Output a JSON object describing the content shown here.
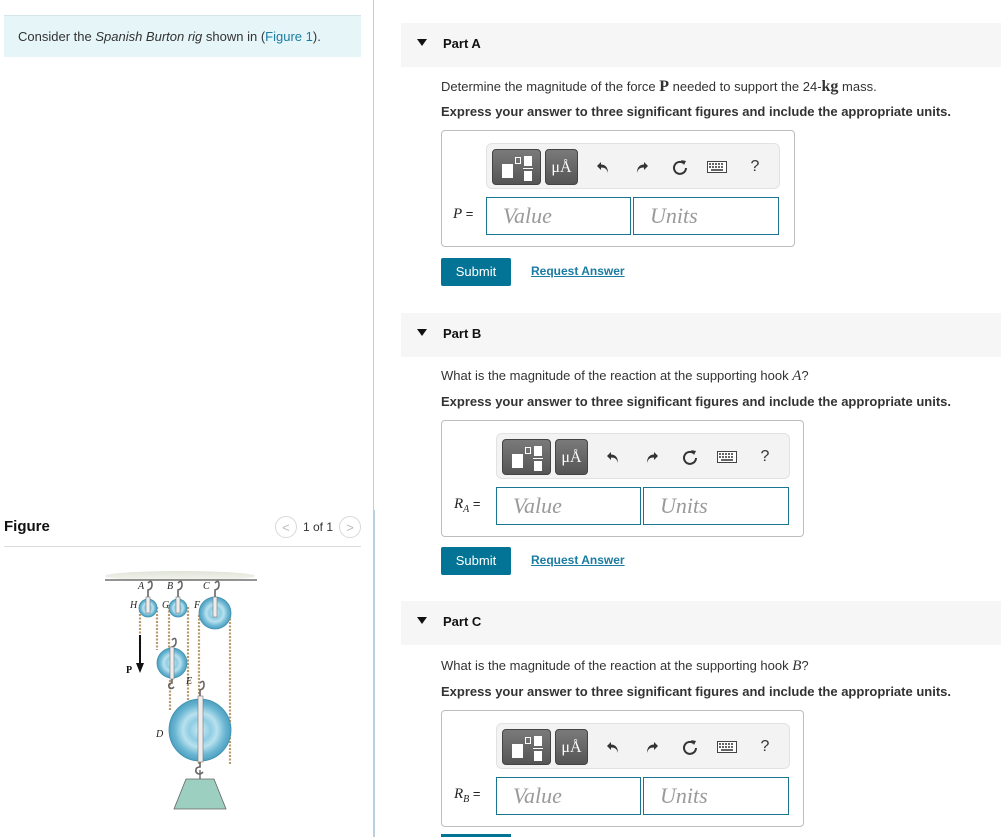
{
  "intro": {
    "prefix": "Consider the ",
    "italic": "Spanish Burton rig",
    "middle": " shown in (",
    "link": "Figure 1",
    "suffix": ")."
  },
  "figure": {
    "title": "Figure",
    "pager": {
      "prev": "<",
      "text": "1 of 1",
      "next": ">"
    },
    "labels": {
      "A": "A",
      "B": "B",
      "C": "C",
      "H": "H",
      "G": "G",
      "F": "F",
      "E": "E",
      "D": "D",
      "P": "P"
    }
  },
  "toolbar": {
    "template_icon": "template-icon",
    "units_label": "μÅ",
    "undo_icon": "undo-icon",
    "redo_icon": "redo-icon",
    "reset_icon": "reset-icon",
    "keyboard_icon": "keyboard-icon",
    "help_label": "?"
  },
  "parts": [
    {
      "title": "Part A",
      "question_pre": "Determine the magnitude of the force ",
      "question_sym": "P",
      "question_mid": " needed to support the 24-",
      "question_unit": "kg",
      "question_post": " mass.",
      "instruction": "Express your answer to three significant figures and include the appropriate units.",
      "eq_var": "P",
      "eq_sub": "",
      "eq_sign": " =",
      "value_placeholder": "Value",
      "units_placeholder": "Units",
      "submit": "Submit",
      "request": "Request Answer"
    },
    {
      "title": "Part B",
      "question_pre": "What is the magnitude of the reaction at the supporting hook ",
      "question_sym": "A",
      "question_post": "?",
      "instruction": "Express your answer to three significant figures and include the appropriate units.",
      "eq_var": "R",
      "eq_sub": "A",
      "eq_sign": " =",
      "value_placeholder": "Value",
      "units_placeholder": "Units",
      "submit": "Submit",
      "request": "Request Answer"
    },
    {
      "title": "Part C",
      "question_pre": "What is the magnitude of the reaction at the supporting hook ",
      "question_sym": "B",
      "question_post": "?",
      "instruction": "Express your answer to three significant figures and include the appropriate units.",
      "eq_var": "R",
      "eq_sub": "B",
      "eq_sign": " =",
      "value_placeholder": "Value",
      "units_placeholder": "Units"
    }
  ],
  "colors": {
    "accent": "#037496",
    "link": "#1a7ca3",
    "intro_bg": "#e6f5f7",
    "part_header_bg": "#f6f6f6",
    "pulley": "#7cc3dc"
  }
}
